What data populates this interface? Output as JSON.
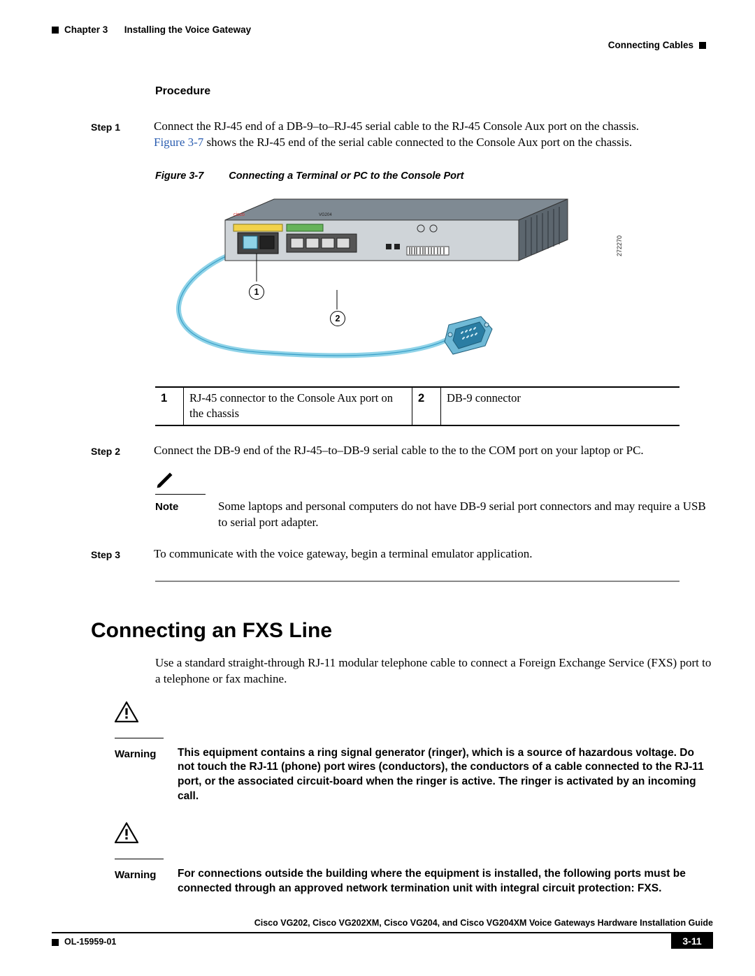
{
  "header": {
    "chapter_label": "Chapter 3",
    "chapter_title": "Installing the Voice Gateway",
    "section_right": "Connecting Cables"
  },
  "procedure_heading": "Procedure",
  "steps": {
    "s1_label": "Step 1",
    "s1_text_a": "Connect the RJ-45 end of a DB-9–to–RJ-45 serial cable to the RJ-45 Console Aux port on the chassis. ",
    "s1_link": "Figure 3-7",
    "s1_text_b": " shows the RJ-45 end of the serial cable connected to the Console Aux port on the chassis.",
    "s2_label": "Step 2",
    "s2_text": "Connect the DB-9 end of the RJ-45–to–DB-9 serial cable to the to the COM port on your laptop or PC.",
    "s3_label": "Step 3",
    "s3_text": "To communicate with the voice gateway, begin a terminal emulator application."
  },
  "figure": {
    "label": "Figure 3-7",
    "title": "Connecting a Terminal or PC to the Console Port",
    "id_label": "272270",
    "device_model": "VG204",
    "callout_1": "1",
    "callout_2": "2"
  },
  "callout_table": {
    "r1_num": "1",
    "r1_desc": "RJ-45 connector to the Console Aux port on the chassis",
    "r2_num": "2",
    "r2_desc": "DB-9 connector"
  },
  "note": {
    "label": "Note",
    "text": "Some laptops and personal computers do not have DB-9 serial port connectors and may require a USB to serial port adapter."
  },
  "section_heading": "Connecting an FXS Line",
  "section_intro": "Use a standard straight-through RJ-11 modular telephone cable to connect a Foreign Exchange Service (FXS) port to a telephone or fax machine.",
  "warnings": {
    "label": "Warning",
    "w1": "This equipment contains a ring signal generator (ringer), which is a source of hazardous voltage. Do not touch the RJ-11 (phone) port wires (conductors), the conductors of a cable connected to the RJ-11 port, or the associated circuit-board when the ringer is active. The ringer is activated by an incoming call.",
    "w2": "For connections outside the building where the equipment is installed, the following ports must be connected through an approved network termination unit with integral circuit protection: FXS."
  },
  "footer": {
    "doc_title": "Cisco VG202, Cisco VG202XM, Cisco VG204, and Cisco VG204XM Voice Gateways Hardware Installation Guide",
    "doc_num": "OL-15959-01",
    "page_num": "3-11"
  }
}
